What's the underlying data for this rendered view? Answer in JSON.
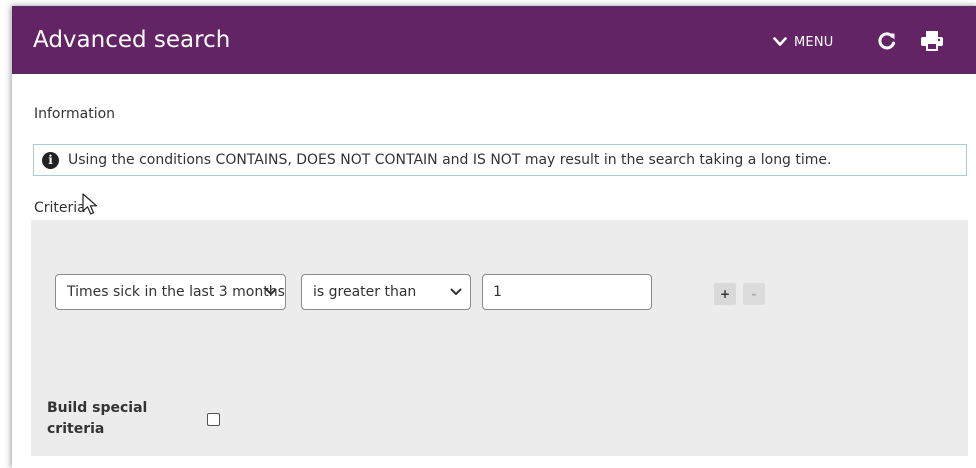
{
  "header": {
    "title": "Advanced search",
    "menu_label": "MENU",
    "icons": {
      "menu": "chevron-down-icon",
      "refresh": "refresh-icon",
      "print": "print-icon"
    }
  },
  "information": {
    "label": "Information",
    "icon": "info-icon",
    "message": "Using the conditions CONTAINS, DOES NOT CONTAIN and IS NOT may result in the search taking a long time."
  },
  "criteria": {
    "label": "Criteria",
    "row": {
      "field_value": "Times sick in the last 3 months",
      "operator_value": "is greater than",
      "value": "1",
      "add_label": "+",
      "remove_label": "-"
    },
    "special": {
      "label": "Build special criteria",
      "checked": false
    }
  },
  "colors": {
    "header_bg": "#632465",
    "panel_bg": "#ececec",
    "info_border": "#a9cfd6"
  }
}
